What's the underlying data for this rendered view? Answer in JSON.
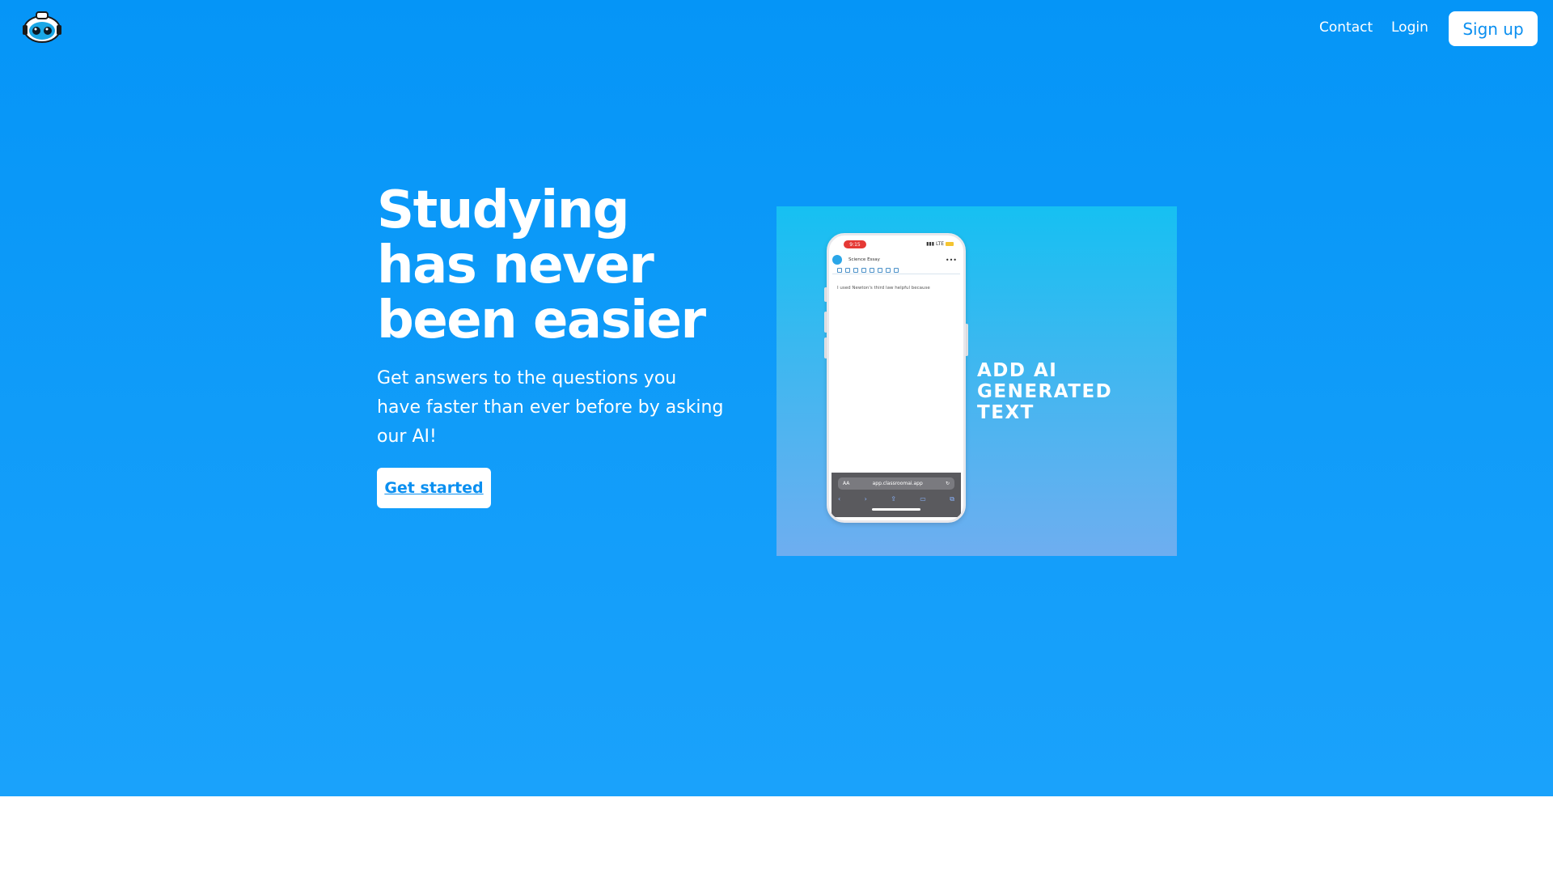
{
  "nav": {
    "contact": "Contact",
    "login": "Login",
    "signup": "Sign up"
  },
  "hero": {
    "headline": "Studying has never been easier",
    "subtext": "Get answers to the questions you have faster than ever before by asking our AI!",
    "cta": "Get started"
  },
  "promo": {
    "caption": "ADD AI GENERATED TEXT",
    "phone": {
      "time": "9:15",
      "network": "LTE",
      "doc_title": "Science Essay",
      "content": "I used Newton's third law helpful because",
      "url": "app.classroomai.app",
      "text_size": "AA",
      "more": "•••"
    }
  },
  "colors": {
    "hero_bg": "#0595f7",
    "accent": "#0a8ff0"
  }
}
